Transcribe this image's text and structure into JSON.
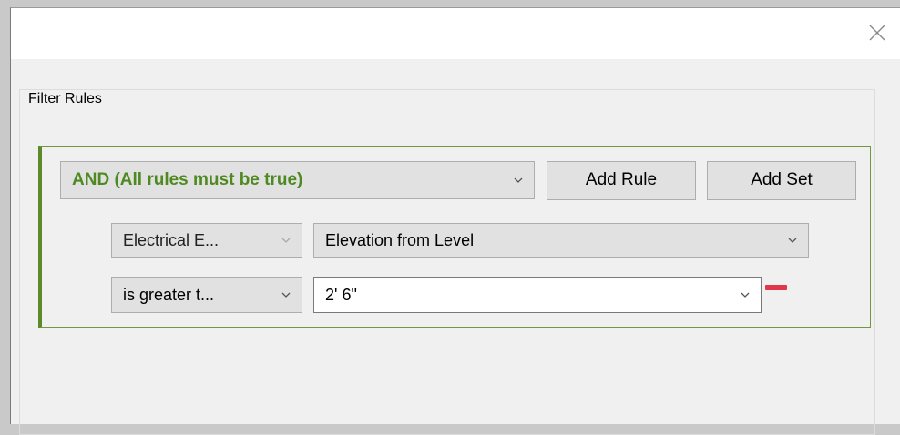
{
  "dialog": {
    "close_icon": "close-icon",
    "group_title": "Filter Rules"
  },
  "rule_set": {
    "operator": "AND (All rules must be true)",
    "add_rule_label": "Add Rule",
    "add_set_label": "Add Set",
    "accent_color": "#5b8a2a"
  },
  "rule": {
    "category": "Electrical E...",
    "parameter": "Elevation from Level",
    "condition": "is greater t...",
    "value": "2'  6\""
  },
  "remove_icon": "minus-icon",
  "remove_color": "#e0384a"
}
